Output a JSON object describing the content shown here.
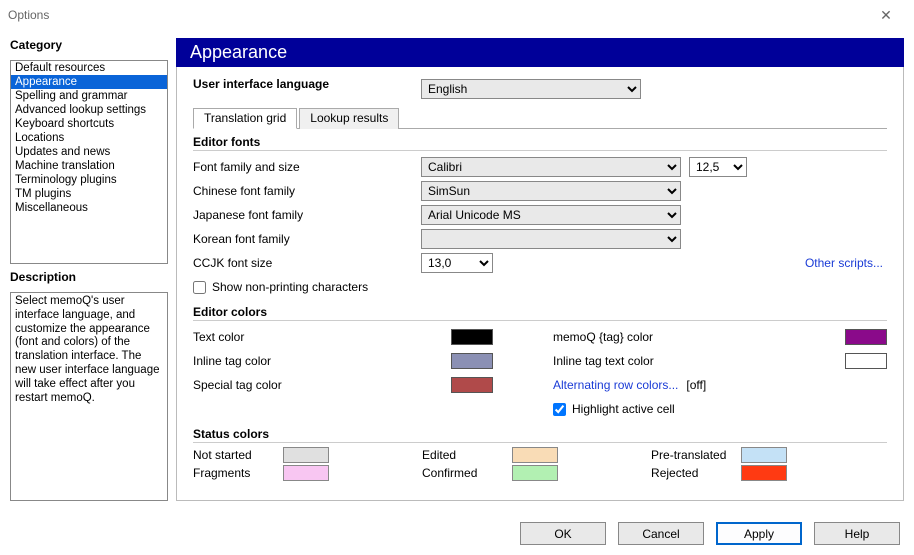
{
  "window": {
    "title": "Options"
  },
  "sidebar": {
    "category_label": "Category",
    "description_label": "Description",
    "items": [
      "Default resources",
      "Appearance",
      "Spelling and grammar",
      "Advanced lookup settings",
      "Keyboard shortcuts",
      "Locations",
      "Updates and news",
      "Machine translation",
      "Terminology plugins",
      "TM plugins",
      "Miscellaneous"
    ],
    "selected_index": 1,
    "description_text": "Select memoQ's user interface language, and customize the appearance (font and colors) of the translation interface. The new user interface language will take effect after you restart memoQ."
  },
  "main": {
    "banner": "Appearance",
    "ui_lang_label": "User interface language",
    "ui_lang_value": "English",
    "tabs": [
      "Translation grid",
      "Lookup results"
    ],
    "active_tab": 0,
    "editor_fonts": {
      "header": "Editor fonts",
      "font_family_label": "Font family and size",
      "font_family_value": "Calibri",
      "font_size_value": "12,5",
      "chinese_label": "Chinese font family",
      "chinese_value": "SimSun",
      "japanese_label": "Japanese font family",
      "japanese_value": "Arial Unicode MS",
      "korean_label": "Korean font family",
      "korean_value": "",
      "ccjk_label": "CCJK font size",
      "ccjk_value": "13,0",
      "other_scripts": "Other scripts...",
      "show_nonprinting": "Show non-printing characters",
      "show_nonprinting_checked": false
    },
    "editor_colors": {
      "header": "Editor colors",
      "text_color_label": "Text color",
      "text_color": "#000000",
      "memoq_tag_label": "memoQ {tag} color",
      "memoq_tag_color": "#8a0a8a",
      "inline_tag_label": "Inline tag color",
      "inline_tag_color": "#8b90b4",
      "inline_tag_text_label": "Inline tag text color",
      "inline_tag_text_color": "#ffffff",
      "special_tag_label": "Special tag color",
      "special_tag_color": "#b04a4a",
      "alternating_label": "Alternating row colors...",
      "alternating_state": "[off]",
      "highlight_label": "Highlight active cell",
      "highlight_checked": true
    },
    "status_colors": {
      "header": "Status colors",
      "not_started": {
        "label": "Not started",
        "color": "#e0e0e0"
      },
      "edited": {
        "label": "Edited",
        "color": "#f9dcb6"
      },
      "pretranslated": {
        "label": "Pre-translated",
        "color": "#c4e1f6"
      },
      "fragments": {
        "label": "Fragments",
        "color": "#f8c6f2"
      },
      "confirmed": {
        "label": "Confirmed",
        "color": "#b2f0b2"
      },
      "rejected": {
        "label": "Rejected",
        "color": "#ff3a12"
      }
    }
  },
  "buttons": {
    "ok": "OK",
    "cancel": "Cancel",
    "apply": "Apply",
    "help": "Help"
  }
}
